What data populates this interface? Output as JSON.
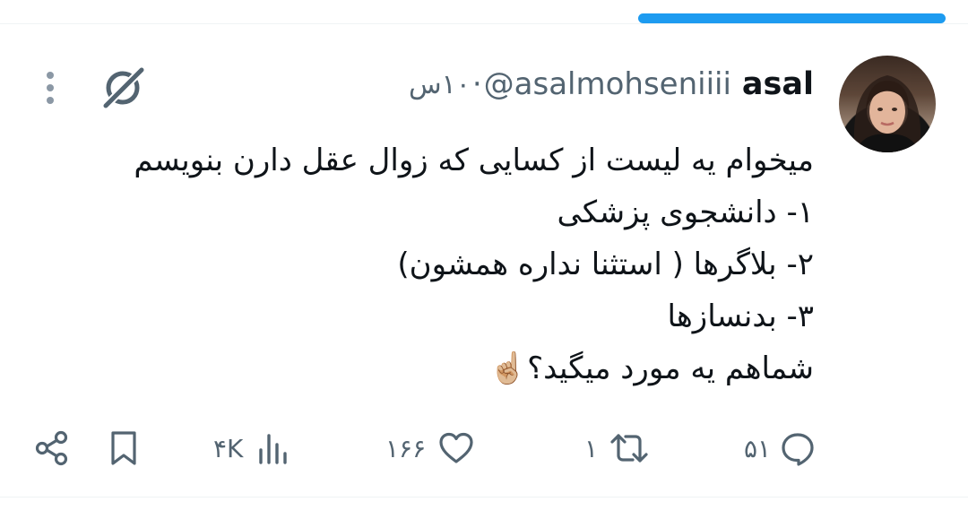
{
  "progress": {
    "fraction": 0.99,
    "color": "#1d9bf0"
  },
  "tweet": {
    "display_name": "asal",
    "handle": "@asalmohseniiii",
    "separator": "·",
    "time": "۱۰س",
    "text_lines": [
      "میخوام یه لیست از کسایی که زوال عقل دارن بنویسم",
      "۱- دانشجوی پزشکی",
      "۲- بلاگرها ( استثنا نداره همشون)",
      "۳- بدنسازها",
      "شماهم یه مورد میگید؟☝🏼"
    ]
  },
  "actions": {
    "reply_count": "۵۱",
    "retweet_count": "۱",
    "like_count": "۱۶۶",
    "views_count": "۴K"
  },
  "icons": {
    "more": "more-vertical-icon",
    "grok": "grok-icon",
    "reply": "reply-icon",
    "retweet": "retweet-icon",
    "like": "heart-icon",
    "views": "views-icon",
    "bookmark": "bookmark-icon",
    "share": "share-icon"
  },
  "colors": {
    "accent": "#1d9bf0",
    "secondary_text": "#536471",
    "primary_text": "#0f1419"
  }
}
